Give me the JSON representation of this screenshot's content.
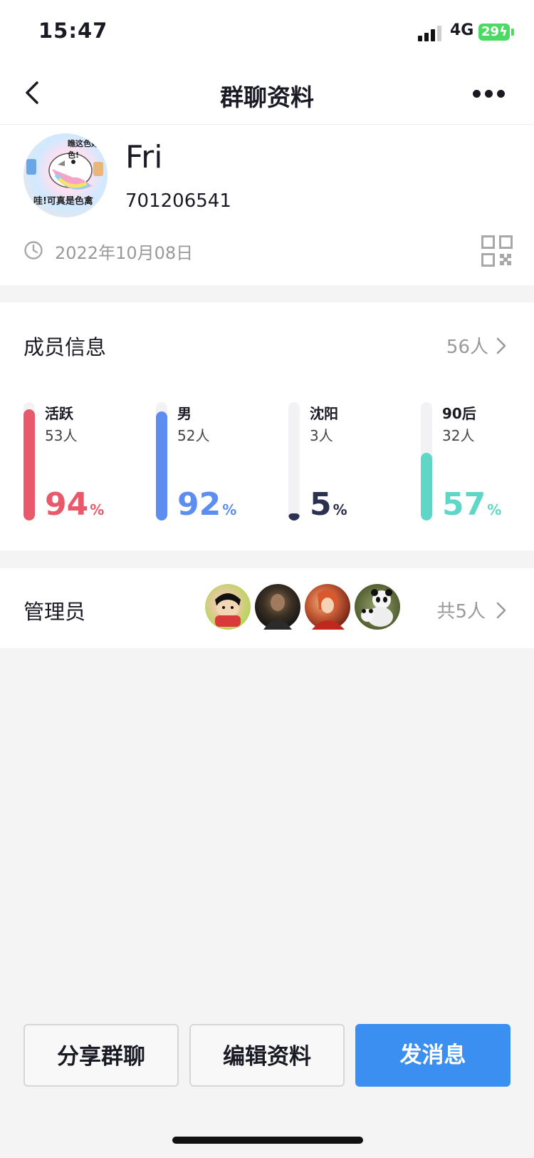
{
  "status_bar": {
    "time": "15:47",
    "network": "4G",
    "battery": "29"
  },
  "nav": {
    "title": "群聊资料"
  },
  "profile": {
    "avatar_text_top": "瞧这色好色!",
    "avatar_text_bottom": "哇!可真是色禽",
    "name": "Fri",
    "id": "701206541",
    "created_date": "2022年10月08日"
  },
  "members": {
    "title": "成员信息",
    "count_label": "56人",
    "stats": [
      {
        "label": "活跃",
        "count": "53人",
        "percent_value": "94",
        "percent_sign": "%",
        "fill": 0.94,
        "color": "#e85a6a"
      },
      {
        "label": "男",
        "count": "52人",
        "percent_value": "92",
        "percent_sign": "%",
        "fill": 0.92,
        "color": "#5b8ef0"
      },
      {
        "label": "沈阳",
        "count": "3人",
        "percent_value": "5",
        "percent_sign": "%",
        "fill": 0.05,
        "color": "#2d3150"
      },
      {
        "label": "90后",
        "count": "32人",
        "percent_value": "57",
        "percent_sign": "%",
        "fill": 0.57,
        "color": "#5fd6c6"
      }
    ]
  },
  "admins": {
    "title": "管理员",
    "count_label": "共5人"
  },
  "actions": {
    "share_label": "分享群聊",
    "edit_label": "编辑资料",
    "message_label": "发消息"
  },
  "colors": {
    "primary": "#3b8ff0"
  }
}
